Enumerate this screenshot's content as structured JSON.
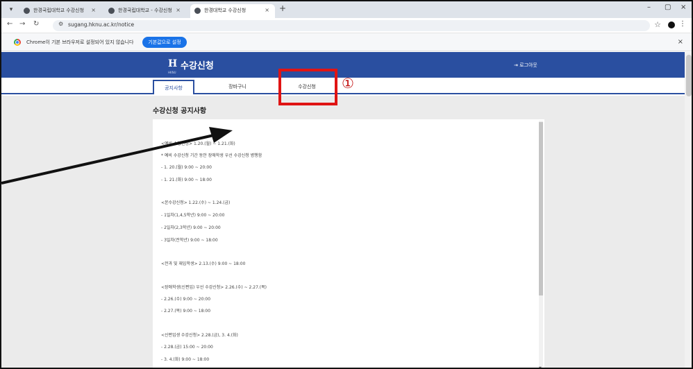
{
  "browser": {
    "tabs": [
      {
        "title": "한경국립대학교 수강신청",
        "icon": "globe-icon"
      },
      {
        "title": "한경국립대학교 - 수강신청",
        "icon": "globe-icon"
      },
      {
        "title": "한경대학교 수강신청",
        "icon": "globe-icon"
      }
    ],
    "close_glyph": "×",
    "new_tab": "+",
    "url": "sugang.hknu.ac.kr/notice",
    "window": {
      "minimize": "–",
      "maximize": "▢",
      "close": "×"
    }
  },
  "infobar": {
    "message": "Chrome이 기본 브라우저로 설정되어 있지 않습니다",
    "button": "기본값으로 설정",
    "close": "×"
  },
  "site": {
    "logo": "H",
    "logo_sub": "HKNU",
    "title": "수강신청",
    "logout": "로그아웃",
    "tabs": [
      "공지사항",
      "장바구니",
      "수강신청"
    ],
    "active_tab": "공지사항",
    "brand_color": "#2a4fa0"
  },
  "notice": {
    "heading": "수강신청 공지사항",
    "lines": [
      "<예비 수강신청> 1.20.(월) ~ 1.21.(화)",
      "* 예비 수강신청 기간 동안 장애학생 우선 수강신청 병행함",
      "- 1. 20.(월) 9:00 ~ 20:00",
      "- 1. 21.(화) 9:00 ~ 18:00",
      "<본수강신청> 1.22.(수) ~ 1.24.(금)",
      "- 1일차(1,4,5학년) 9:00 ~ 20:00",
      "- 2일차(2,3학년) 9:00 ~ 20:00",
      "- 3일차(전학년) 9:00 ~ 18:00",
      "<전과 및 재입학생> 2.13.(수) 9:00 ~ 18:00",
      "<장애학생(신편입) 우선 수강신청> 2.26.(수) ~ 2.27.(목)",
      "- 2.26.(수) 9:00 ~ 20:00",
      "- 2.27.(목) 9:00 ~ 18:00",
      "<신편입생 수강신청> 2.28.(금), 3. 4.(화)",
      "- 2.28.(금) 15:00 ~ 20:00",
      "- 3. 4.(화) 9:00 ~ 18:00"
    ]
  },
  "annotation": {
    "marker": "①",
    "color": "#e01414"
  }
}
